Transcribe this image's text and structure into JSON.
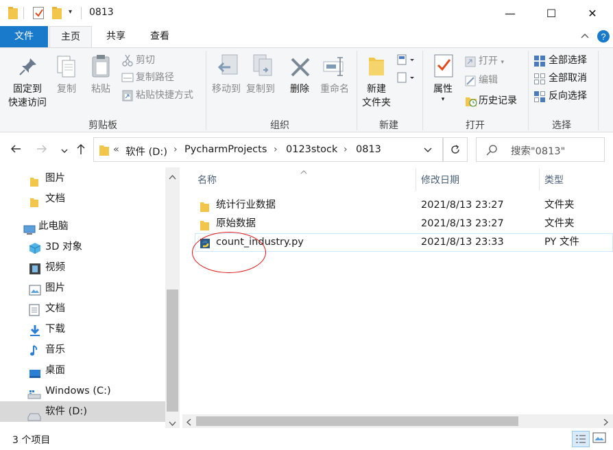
{
  "window": {
    "title": "0813",
    "minimize_glyph": "—",
    "maximize_glyph": "☐",
    "close_glyph": "✕"
  },
  "ribbon_tabs": [
    {
      "label": "文件"
    },
    {
      "label": "主页"
    },
    {
      "label": "共享"
    },
    {
      "label": "查看"
    }
  ],
  "ribbon": {
    "clipboard": {
      "label": "剪贴板",
      "pin_line1": "固定到",
      "pin_line2": "快速访问",
      "copy": "复制",
      "paste": "粘贴",
      "cut": "剪切",
      "copy_path": "复制路径",
      "paste_shortcut": "粘贴快捷方式"
    },
    "organize": {
      "label": "组织",
      "move_to": "移动到",
      "copy_to": "复制到",
      "delete": "删除",
      "rename": "重命名"
    },
    "new": {
      "label": "新建",
      "new_folder_line1": "新建",
      "new_folder_line2": "文件夹"
    },
    "open": {
      "label": "打开",
      "properties": "属性",
      "open": "打开",
      "edit": "编辑",
      "history": "历史记录"
    },
    "select": {
      "label": "选择",
      "select_all": "全部选择",
      "select_none": "全部取消",
      "invert": "反向选择"
    }
  },
  "address": {
    "overflow": "«",
    "crumbs": [
      "软件 (D:)",
      "PycharmProjects",
      "0123stock",
      "0813"
    ],
    "sep": "›",
    "search_placeholder": "搜索\"0813\""
  },
  "nav": {
    "items": [
      {
        "label": "图片"
      },
      {
        "label": "文档"
      },
      {
        "label": "此电脑"
      },
      {
        "label": "3D 对象"
      },
      {
        "label": "视频"
      },
      {
        "label": "图片"
      },
      {
        "label": "文档"
      },
      {
        "label": "下载"
      },
      {
        "label": "音乐"
      },
      {
        "label": "桌面"
      },
      {
        "label": "Windows (C:)"
      },
      {
        "label": "软件 (D:)"
      }
    ]
  },
  "files": {
    "columns": [
      "名称",
      "修改日期",
      "类型"
    ],
    "rows": [
      {
        "name": "统计行业数据",
        "date": "2021/8/13 23:27",
        "type": "文件夹"
      },
      {
        "name": "原始数据",
        "date": "2021/8/13 23:27",
        "type": "文件夹"
      },
      {
        "name": "count_industry.py",
        "date": "2021/8/13 23:33",
        "type": "PY 文件"
      }
    ]
  },
  "status": {
    "count": "3 个项目"
  },
  "colors": {
    "file_tab": "#1979ca",
    "selection": "#cce8ff",
    "folder": "#f2c54b",
    "annotation": "#e01010"
  }
}
